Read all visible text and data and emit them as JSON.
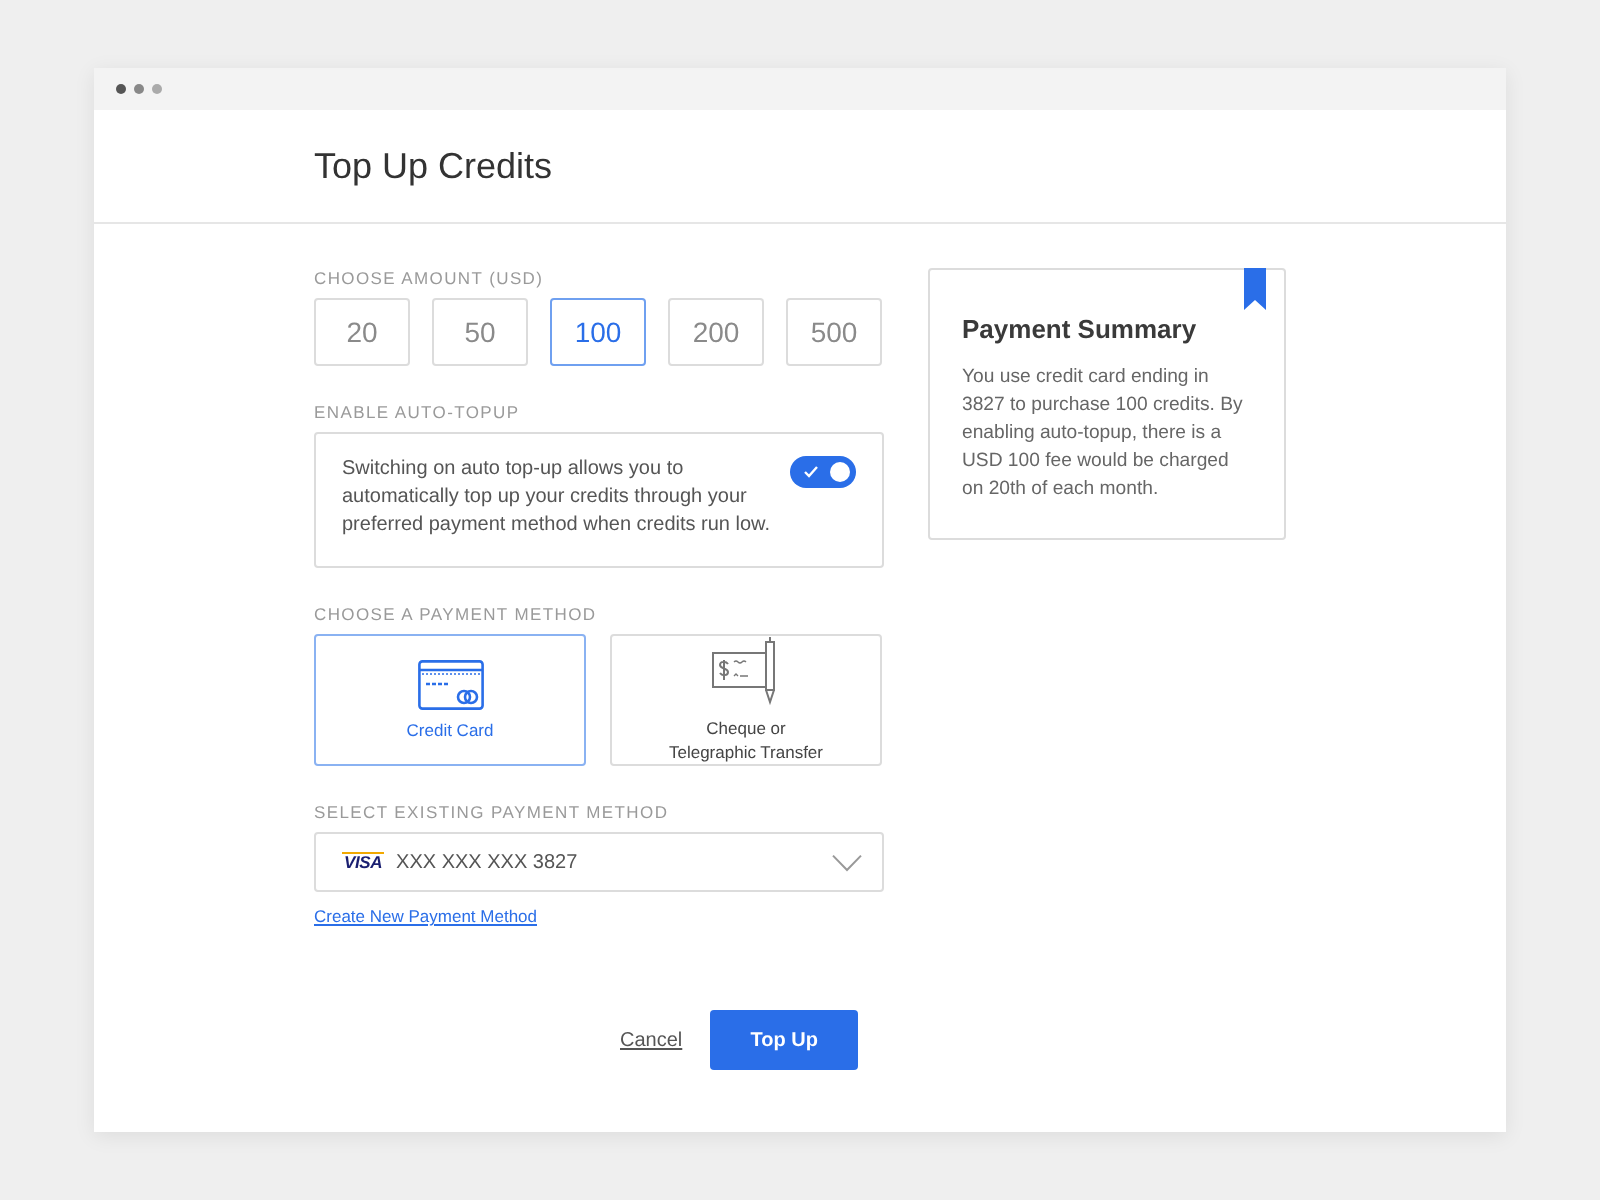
{
  "header": {
    "title": "Top Up Credits"
  },
  "amount": {
    "label": "CHOOSE AMOUNT (USD)",
    "options": [
      {
        "label": "20",
        "selected": false
      },
      {
        "label": "50",
        "selected": false
      },
      {
        "label": "100",
        "selected": true
      },
      {
        "label": "200",
        "selected": false
      },
      {
        "label": "500",
        "selected": false
      }
    ]
  },
  "auto_topup": {
    "label": "ENABLE AUTO-TOPUP",
    "description": "Switching on auto top-up allows you to automatically top up your credits through your preferred payment method when credits run low.",
    "on": true
  },
  "payment_method": {
    "label": "CHOOSE A PAYMENT METHOD",
    "options": [
      {
        "kind": "card",
        "label": "Credit Card",
        "selected": true
      },
      {
        "kind": "cheque",
        "label": "Cheque or\nTelegraphic Transfer",
        "selected": false
      }
    ]
  },
  "existing_method": {
    "label": "SELECT EXISTING PAYMENT METHOD",
    "brand": "VISA",
    "value": "XXX XXX XXX 3827"
  },
  "create_link": "Create New Payment Method",
  "actions": {
    "cancel": "Cancel",
    "submit": "Top Up"
  },
  "summary": {
    "title": "Payment Summary",
    "text": "You use credit card ending in 3827 to purchase 100 credits. By enabling auto-topup, there is a USD 100 fee would be charged on 20th of each month."
  }
}
